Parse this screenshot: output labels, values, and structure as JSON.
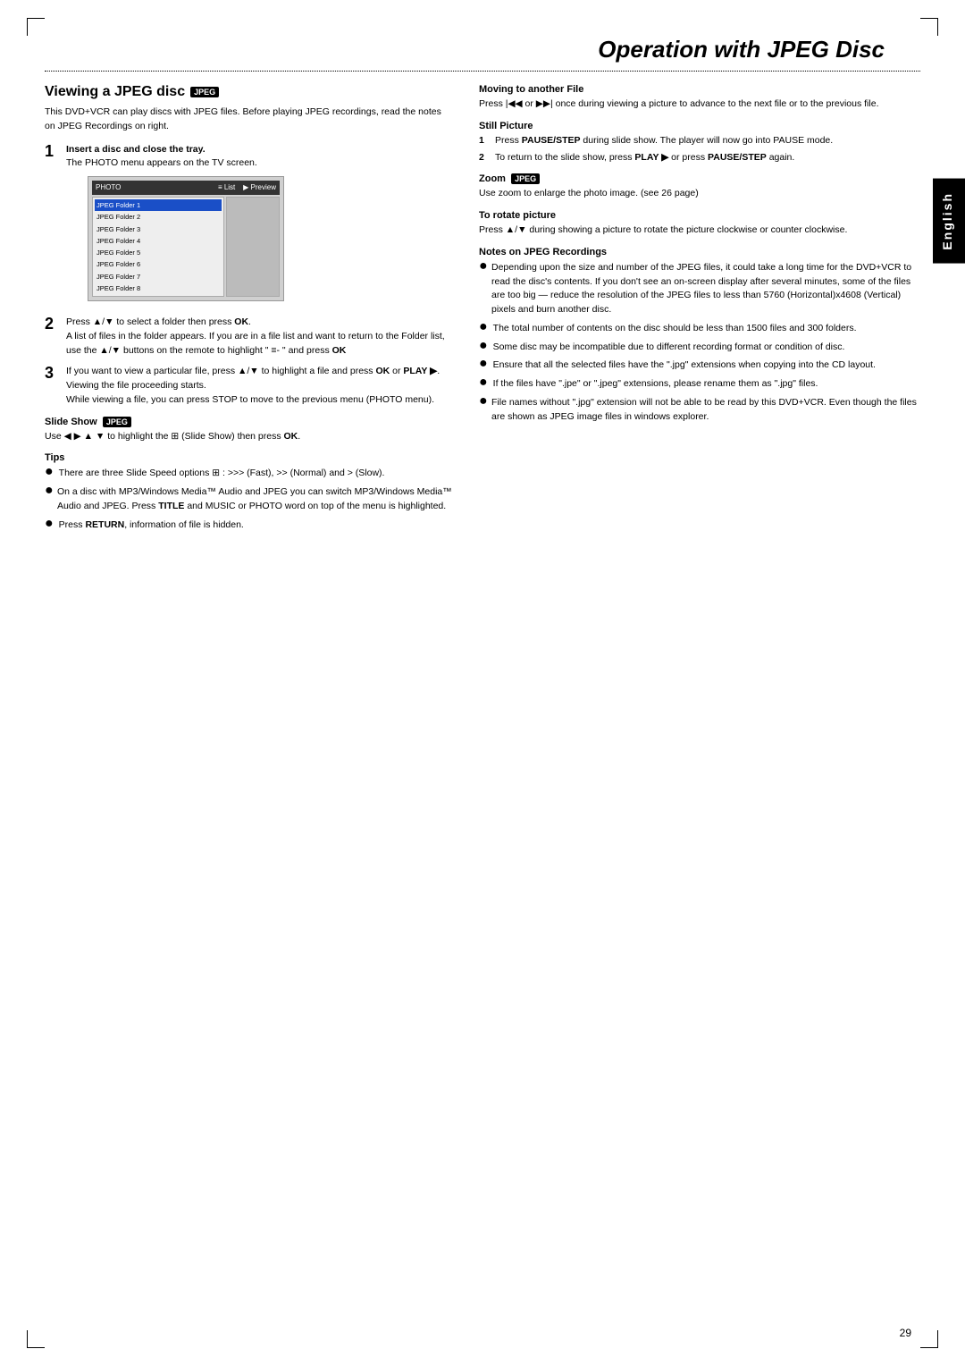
{
  "page": {
    "title": "Operation with JPEG Disc",
    "page_number": "29",
    "side_tab": "English"
  },
  "left_column": {
    "section_title": "Viewing a JPEG disc",
    "section_title_badge": "JPEG",
    "intro": "This DVD+VCR can play discs with JPEG files. Before playing JPEG recordings, read the notes on JPEG Recordings on right.",
    "steps": [
      {
        "number": "1",
        "title": "Insert a disc and close the tray.",
        "body": "The PHOTO menu appears on the TV screen."
      },
      {
        "number": "2",
        "body_html": "Press ▲/▼ to select a folder then press OK. A list of files in the folder appears. If you are in a file list and want to return to the Folder list, use the ▲/▼ buttons on the remote to highlight \" ≡- \" and press OK"
      },
      {
        "number": "3",
        "body_html": "If you want to view a particular file, press ▲/▼ to highlight a file and press OK or PLAY ▶. Viewing the file proceeding starts. While viewing a file, you can press STOP to move to the previous menu (PHOTO menu)."
      }
    ],
    "menu": {
      "header_left": "PHOTO",
      "header_tab1": "≡ List",
      "header_tab2": "▶ Preview",
      "items": [
        {
          "label": "JPEG Folder 1",
          "highlighted": true
        },
        {
          "label": "JPEG Folder 2",
          "highlighted": false
        },
        {
          "label": "JPEG Folder 3",
          "highlighted": false
        },
        {
          "label": "JPEG Folder 4",
          "highlighted": false
        },
        {
          "label": "JPEG Folder 5",
          "highlighted": false
        },
        {
          "label": "JPEG Folder 6",
          "highlighted": false
        },
        {
          "label": "JPEG Folder 7",
          "highlighted": false
        },
        {
          "label": "JPEG Folder 8",
          "highlighted": false
        }
      ]
    },
    "slide_show": {
      "title": "Slide Show",
      "badge": "JPEG",
      "body": "Use ◀ ▶ ▲ ▼ to highlight the ⊞ (Slide Show) then press OK."
    },
    "tips": {
      "title": "Tips",
      "items": [
        "There are three Slide Speed options ⊞ : >>> (Fast), >> (Normal) and > (Slow).",
        "On a disc with MP3/Windows Media™ Audio and JPEG you can switch MP3/Windows Media™ Audio and JPEG. Press TITLE and MUSIC or PHOTO word on top of the menu is highlighted.",
        "Press RETURN, information of file is hidden."
      ]
    }
  },
  "right_column": {
    "moving_to_another_file": {
      "title": "Moving to another File",
      "body": "Press |◀◀ or ▶▶| once during viewing a picture to advance to the next file or to the previous file."
    },
    "still_picture": {
      "title": "Still Picture",
      "steps": [
        "Press PAUSE/STEP during slide show. The player will now go into PAUSE mode.",
        "To return to the slide show, press PLAY ▶ or press PAUSE/STEP again."
      ]
    },
    "zoom": {
      "title": "Zoom",
      "badge": "JPEG",
      "body": "Use zoom to enlarge the photo image. (see 26 page)"
    },
    "rotate": {
      "title": "To rotate picture",
      "body": "Press ▲/▼ during showing a picture to rotate the picture clockwise or counter clockwise."
    },
    "notes": {
      "title": "Notes on JPEG Recordings",
      "items": [
        "Depending upon the size and number of the JPEG files, it could take a long time for the DVD+VCR to read the disc's contents. If you don't see an on-screen display after several minutes, some of the files are too big — reduce the resolution of the JPEG files to less than 5760 (Horizontal)x4608 (Vertical) pixels and burn another disc.",
        "The total number of contents on the disc should be less than 1500 files and 300 folders.",
        "Some disc may be incompatible due to different recording format or condition of disc.",
        "Ensure that all the selected files have the \".jpg\" extensions when copying into the CD layout.",
        "If the files have \".jpe\" or \".jpeg\" extensions, please rename them as \".jpg\" files.",
        "File names without \".jpg\" extension will not be able to be read by this DVD+VCR. Even though the files are shown as JPEG image files in windows explorer."
      ]
    }
  }
}
